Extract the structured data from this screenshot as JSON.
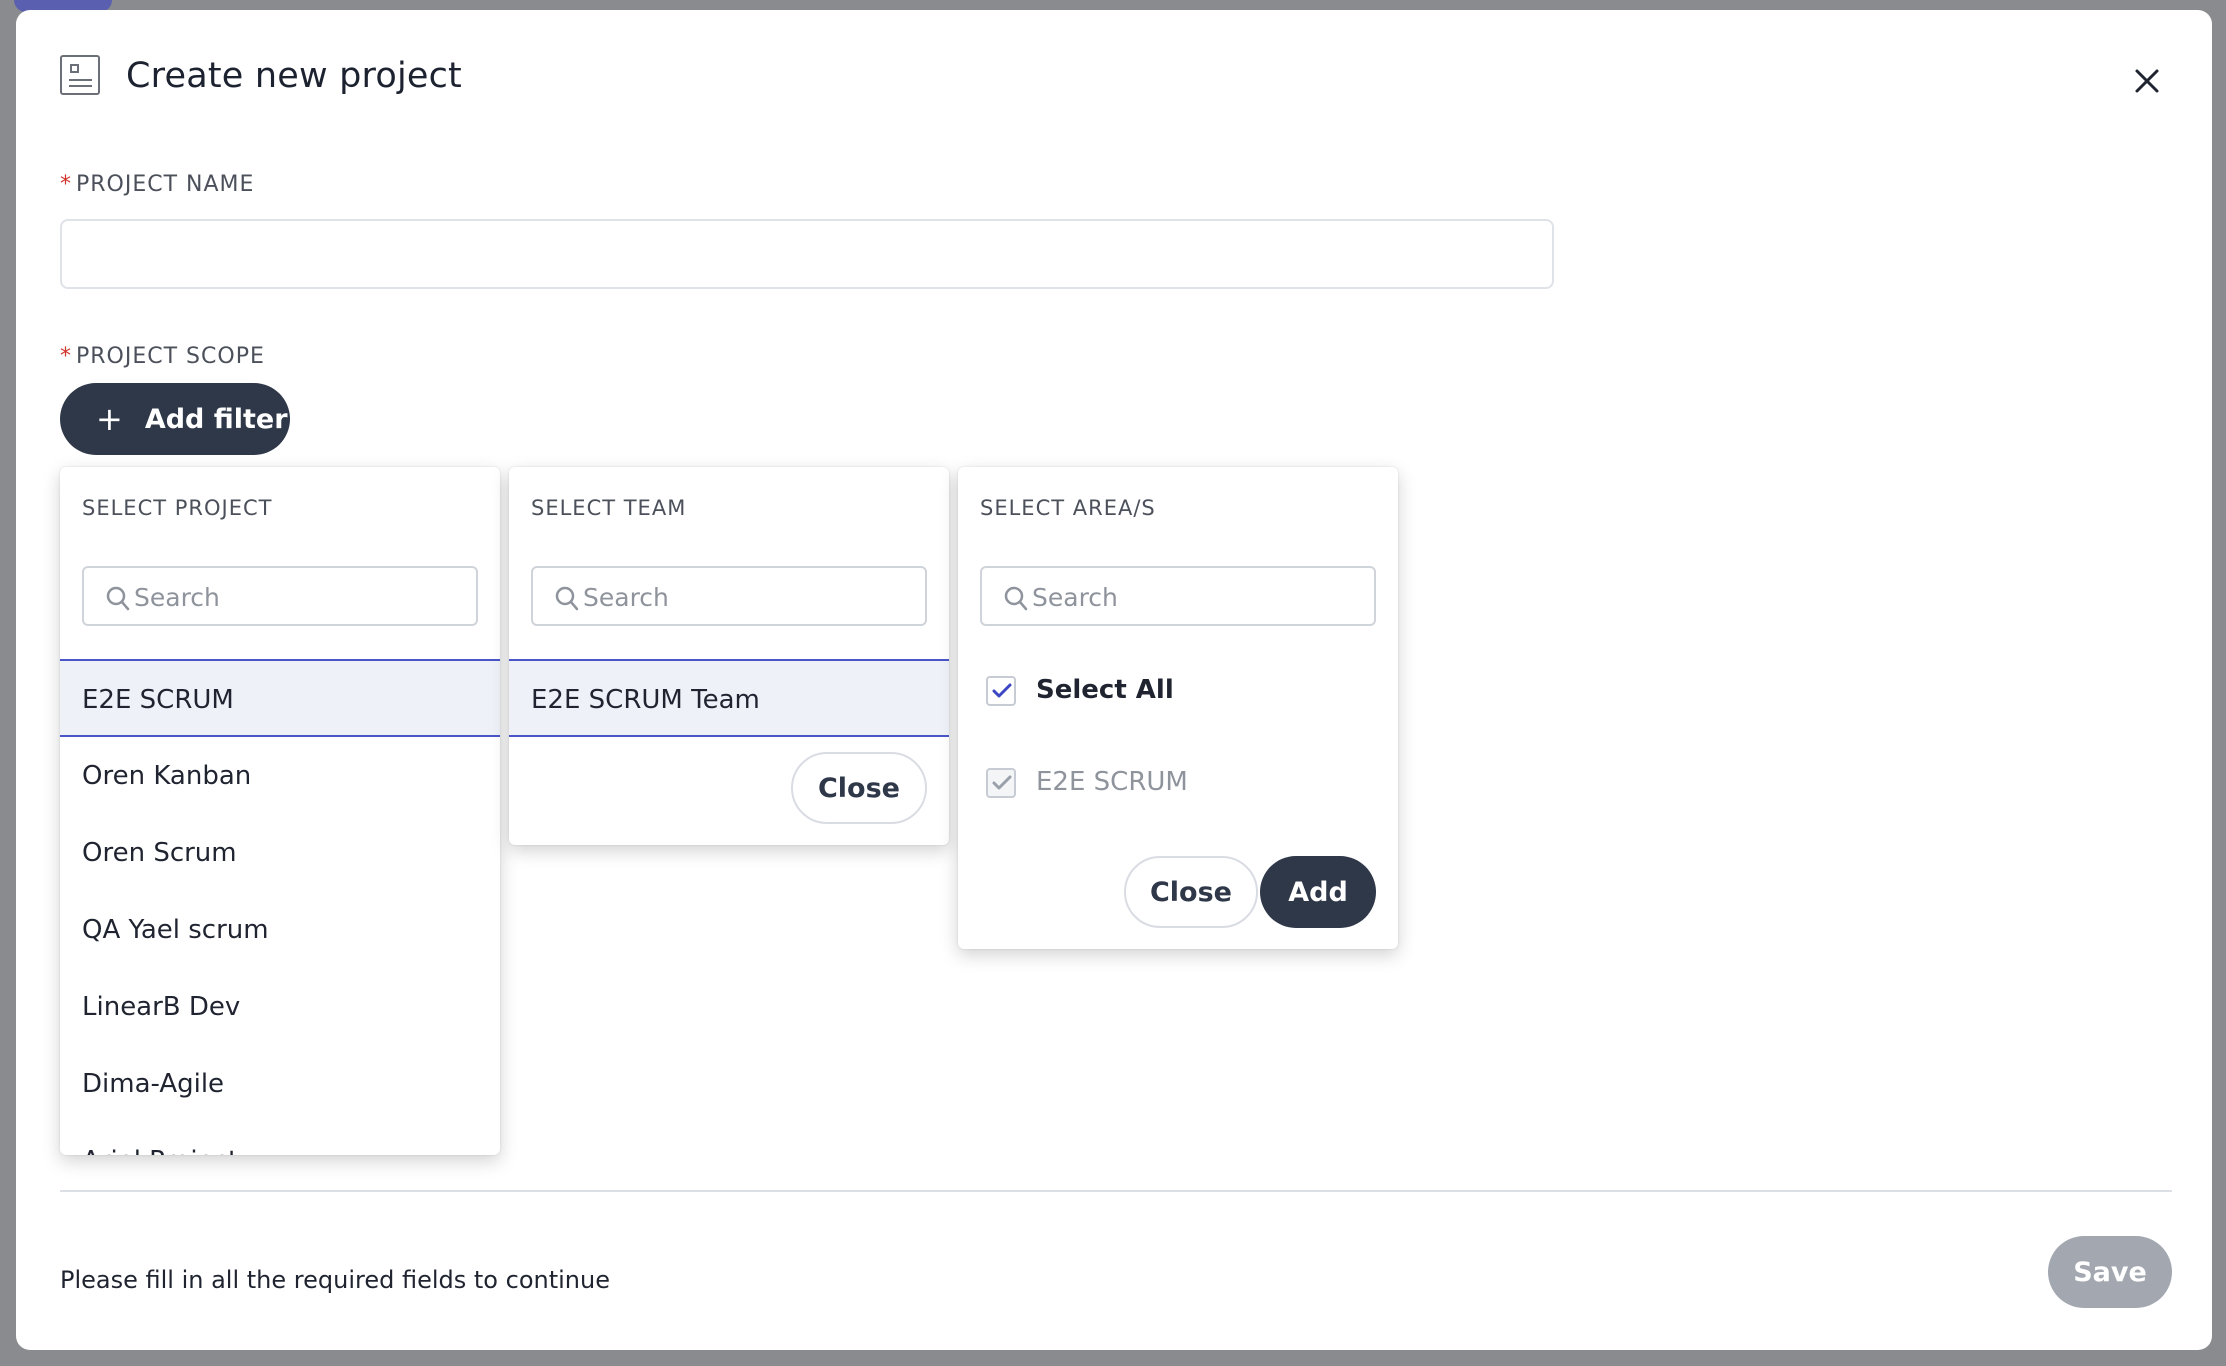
{
  "modal": {
    "title": "Create new project",
    "project_name": {
      "label": "PROJECT NAME",
      "required_mark": "*",
      "value": "",
      "placeholder": ""
    },
    "project_scope": {
      "label": "PROJECT SCOPE",
      "required_mark": "*",
      "add_filter_label": "Add filter"
    },
    "footer": {
      "message": "Please fill in all the required fields to continue",
      "save_label": "Save"
    }
  },
  "select_project": {
    "title": "SELECT PROJECT",
    "search_placeholder": "Search",
    "items": [
      {
        "label": "E2E SCRUM",
        "selected": true
      },
      {
        "label": "Oren Kanban"
      },
      {
        "label": "Oren Scrum"
      },
      {
        "label": "QA Yael scrum"
      },
      {
        "label": "LinearB Dev"
      },
      {
        "label": "Dima-Agile"
      },
      {
        "label": "Ariel Project"
      }
    ]
  },
  "select_team": {
    "title": "SELECT TEAM",
    "search_placeholder": "Search",
    "items": [
      {
        "label": "E2E SCRUM Team",
        "selected": true
      }
    ],
    "close_label": "Close"
  },
  "select_area": {
    "title": "SELECT AREA/S",
    "search_placeholder": "Search",
    "select_all_label": "Select All",
    "select_all_checked": true,
    "items": [
      {
        "label": "E2E SCRUM",
        "checked": true,
        "disabled": true
      }
    ],
    "close_label": "Close",
    "add_label": "Add"
  },
  "colors": {
    "primary_dark": "#2f3849",
    "selection_border": "#4a56c8",
    "required": "#d0342c",
    "save_disabled": "#a3a8b0"
  },
  "icons": {
    "header": "project-card-icon",
    "close": "close-icon",
    "add": "plus-icon",
    "search": "search-icon",
    "check": "check-icon"
  }
}
